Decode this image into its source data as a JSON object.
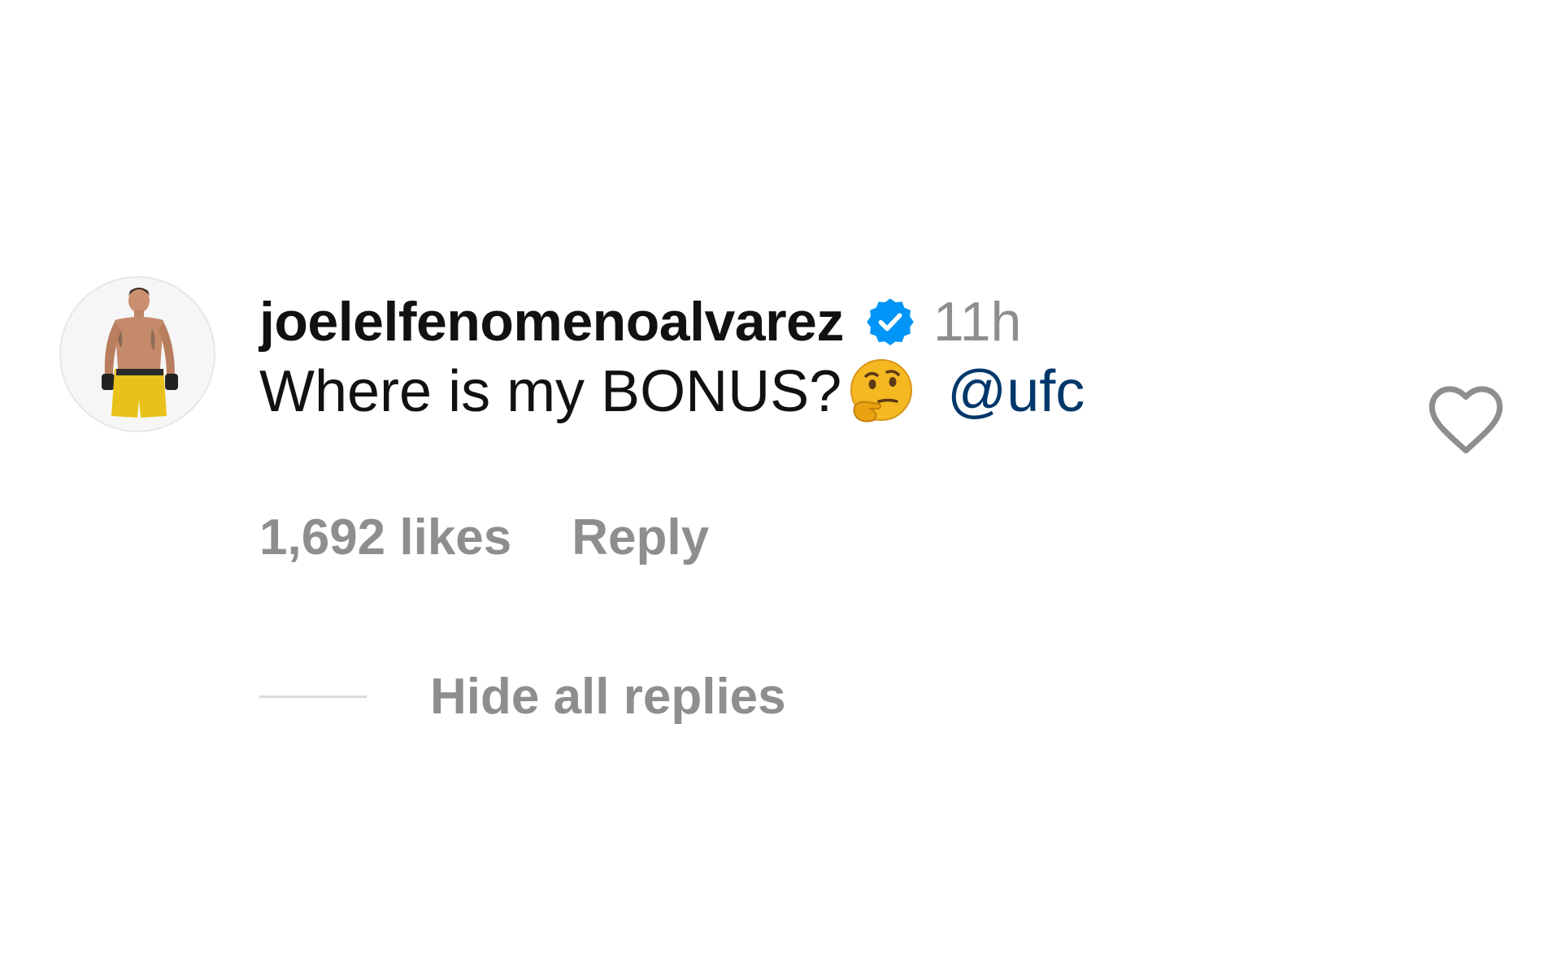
{
  "comment": {
    "username": "joelelfenomenoalvarez",
    "timestamp": "11h",
    "text": "Where is my BONUS?",
    "mention": "@ufc",
    "likes": "1,692 likes",
    "reply_label": "Reply",
    "hide_replies_label": "Hide all replies"
  },
  "icons": {
    "verified": "verified-badge-icon",
    "emoji": "thinking-face-emoji-icon",
    "like": "heart-outline-icon"
  },
  "colors": {
    "verified_blue": "#0095f6",
    "muted_text": "#8e8e8e",
    "primary_text": "#111111",
    "mention": "#00376b"
  }
}
